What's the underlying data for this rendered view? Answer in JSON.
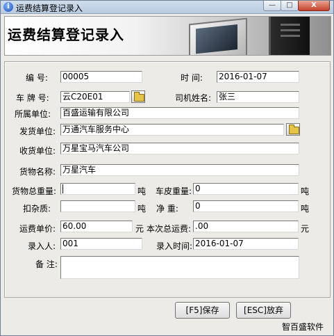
{
  "window": {
    "title": "运费结算登记录入",
    "app_icon": "info-icon"
  },
  "window_controls": {
    "minimize": "—",
    "maximize": "□",
    "close": "X"
  },
  "banner": {
    "title": "运费结算登记录入"
  },
  "form": {
    "bianhao": {
      "label": "编    号:",
      "value": "00005"
    },
    "shijian": {
      "label": "时    间:",
      "value": "2016-01-07"
    },
    "chepaihao": {
      "label": "车 牌 号:",
      "value": "云C20E01"
    },
    "sijixingming": {
      "label": "司机姓名:",
      "value": "张三"
    },
    "suoshudanwei": {
      "label": "所属单位:",
      "value": "百盛运输有限公司"
    },
    "fahuodanwei": {
      "label": "发货单位:",
      "value": "万通汽车服务中心"
    },
    "shouhuodanwei": {
      "label": "收货单位:",
      "value": "万星宝马汽车公司"
    },
    "huowumingcheng": {
      "label": "货物名称:",
      "value": "万星汽车"
    },
    "huowuzongzhongliang": {
      "label": "货物总重量:",
      "value": "",
      "unit": "吨"
    },
    "chepizhongliang": {
      "label": "车皮重量:",
      "value": "0",
      "unit": "吨"
    },
    "kouzazhi": {
      "label": "扣杂质:",
      "value": "",
      "unit": "吨"
    },
    "jingzhong": {
      "label": "净    重:",
      "value": "0",
      "unit": "吨"
    },
    "yunfeidanjia": {
      "label": "运费单价:",
      "value": "60.00",
      "unit": "元"
    },
    "benci_zongyunfei": {
      "label": "本次总运费:",
      "value": ".00",
      "unit": "元"
    },
    "lururen": {
      "label": "录入人:",
      "value": "001"
    },
    "lurushijian": {
      "label": "录入时间:",
      "value": "2016-01-07"
    },
    "beizhu": {
      "label": "备 注:",
      "value": ""
    }
  },
  "buttons": {
    "save": "[F5]保存",
    "abandon": "[ESC]放弃"
  },
  "footer": {
    "brand": "智百盛软件"
  }
}
